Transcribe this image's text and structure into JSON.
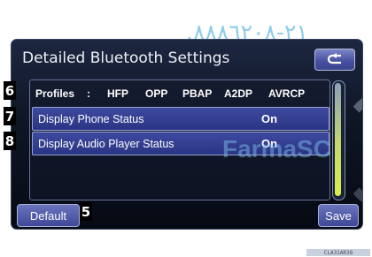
{
  "watermark": {
    "top_text": ".٢١-٨٨٨٦٢٠٨",
    "screen_text": "FarmaSC"
  },
  "header": {
    "title": "Detailed Bluetooth Settings",
    "back_icon": "return-arrow-icon"
  },
  "profiles": {
    "badge": "6",
    "label": "Profiles",
    "separator": ":",
    "items": [
      "HFP",
      "OPP",
      "PBAP",
      "A2DP",
      "AVRCP"
    ]
  },
  "rows": [
    {
      "badge": "7",
      "label": "Display Phone Status",
      "value": "On"
    },
    {
      "badge": "8",
      "label": "Display Audio Player Status",
      "value": "On"
    }
  ],
  "footer": {
    "default_label": "Default",
    "default_badge": "5",
    "save_label": "Save",
    "catalog_code": "CLA31AR38"
  },
  "colors": {
    "screen_bg": "#0e1524",
    "button": "#4a53a1",
    "row_highlight": "#3e4aa0",
    "scroll_thumb": "#d8ef4a"
  }
}
